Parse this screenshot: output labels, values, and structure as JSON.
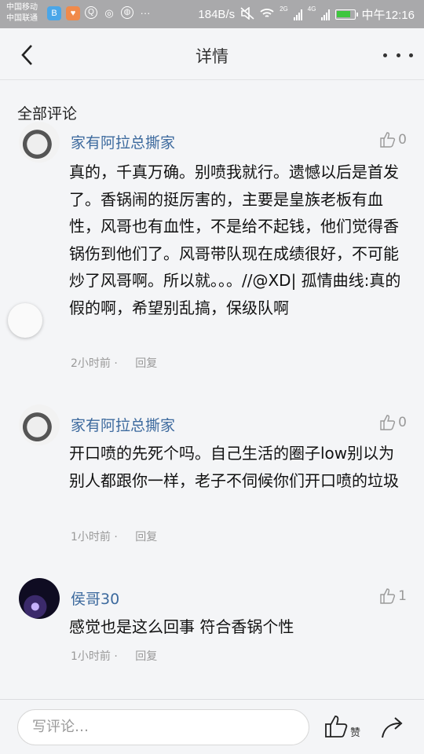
{
  "status_bar": {
    "carrier1": "中国移动",
    "carrier2": "中国联通",
    "speed": "184B/s",
    "network1": "2G",
    "network2": "4G",
    "time": "中午12:16",
    "icons": [
      "b-app-icon",
      "heart-app-icon",
      "qq-icon",
      "eye-icon",
      "browser-icon",
      "more-dots-icon",
      "mute-icon",
      "wifi-icon",
      "signal-icon",
      "battery-icon"
    ]
  },
  "nav": {
    "title": "详情"
  },
  "section_title": "全部评论",
  "comments": [
    {
      "username": "家有阿拉总撕家",
      "likes": "0",
      "text": "真的，千真万确。别喷我就行。遗憾以后是首发了。香锅闹的挺厉害的，主要是皇族老板有血性，风哥也有血性，不是给不起钱，他们觉得香锅伤到他们了。风哥带队现在成绩很好，不可能炒了风哥啊。所以就。。。//@XD| 孤情曲线:真的假的啊，希望别乱搞，保级队啊",
      "time": "2小时前",
      "reply": "回复"
    },
    {
      "username": "家有阿拉总撕家",
      "likes": "0",
      "text": "开口喷的先死个吗。自己生活的圈子low别以为别人都跟你一样，老子不伺候你们开口喷的垃圾",
      "time": "1小时前",
      "reply": "回复"
    },
    {
      "username": "侯哥30",
      "likes": "1",
      "text": "感觉也是这么回事 符合香锅个性",
      "time": "1小时前",
      "reply": "回复"
    }
  ],
  "bottom": {
    "placeholder": "写评论…",
    "like_label": "赞"
  }
}
